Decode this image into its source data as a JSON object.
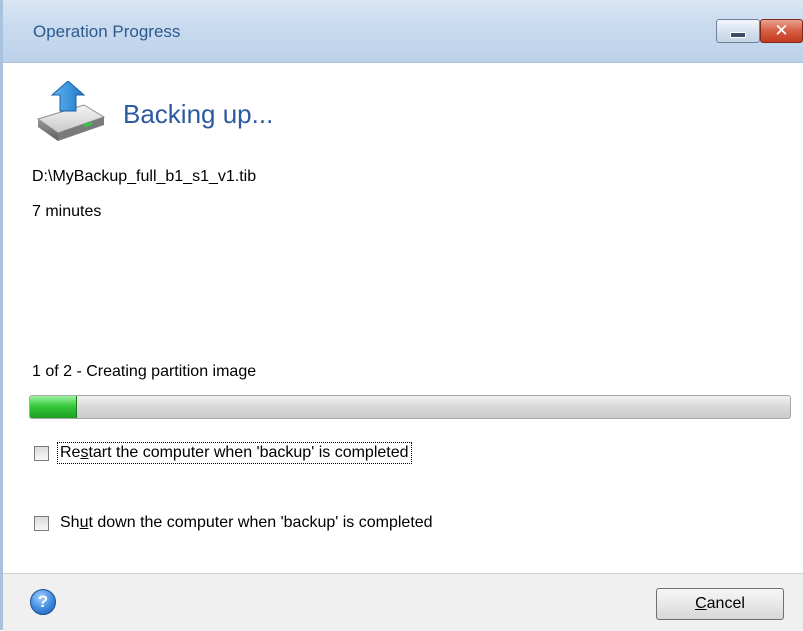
{
  "window": {
    "title": "Operation Progress",
    "minimize_symbol": "",
    "close_symbol": "✕"
  },
  "operation": {
    "icon": "backup-drive-upload-icon",
    "heading": "Backing up...",
    "file_path": "D:\\MyBackup_full_b1_s1_v1.tib",
    "time_remaining": "7 minutes",
    "step_text": "1 of 2 - Creating partition image",
    "progress_percent": 6
  },
  "options": {
    "restart": {
      "label_before": "Re",
      "label_accel": "s",
      "label_after": "tart the computer when 'backup' is completed",
      "checked": false
    },
    "shutdown": {
      "label_before": "Sh",
      "label_accel": "u",
      "label_after": "t down the computer when 'backup' is completed",
      "checked": false
    }
  },
  "footer": {
    "help_icon": "help-icon",
    "help_symbol": "?",
    "cancel_accel": "C",
    "cancel_rest": "ancel"
  },
  "colors": {
    "heading": "#2c5aa0",
    "progress_fill": "#38c93d",
    "title_text": "#2d5a8d"
  }
}
